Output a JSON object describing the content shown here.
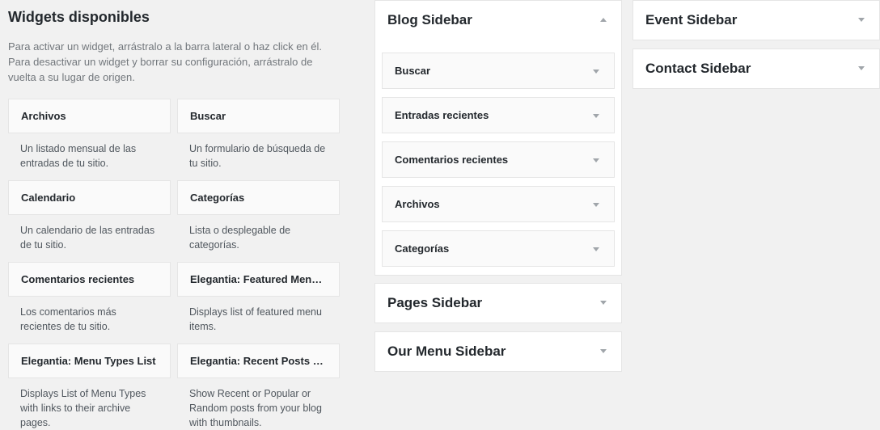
{
  "available": {
    "title": "Widgets disponibles",
    "description_line1": "Para activar un widget, arrástralo a la barra lateral o haz click en él.",
    "description_line2": "Para desactivar un widget y borrar su configuración, arrástralo de",
    "description_line3": "vuelta a su lugar de origen.",
    "widgets": [
      {
        "title": "Archivos",
        "desc_line1": "Un listado mensual de las",
        "desc_line2": "entradas de tu sitio.",
        "desc_line3": ""
      },
      {
        "title": "Buscar",
        "desc_line1": "Un formulario de búsqueda de",
        "desc_line2": "tu sitio.",
        "desc_line3": ""
      },
      {
        "title": "Calendario",
        "desc_line1": "Un calendario de las entradas",
        "desc_line2": "de tu sitio.",
        "desc_line3": ""
      },
      {
        "title": "Categorías",
        "desc_line1": "Lista o desplegable de",
        "desc_line2": "categorías.",
        "desc_line3": ""
      },
      {
        "title": "Comentarios recientes",
        "desc_line1": "Los comentarios más",
        "desc_line2": "recientes de tu sitio.",
        "desc_line3": ""
      },
      {
        "title": "Elegantia: Featured Menu Items",
        "desc_line1": "Displays list of featured menu",
        "desc_line2": "items.",
        "desc_line3": ""
      },
      {
        "title": "Elegantia: Menu Types List",
        "desc_line1": "Displays List of Menu Types",
        "desc_line2": "with links to their archive",
        "desc_line3": "pages."
      },
      {
        "title": "Elegantia: Recent Posts Widget",
        "desc_line1": "Show Recent or Popular or",
        "desc_line2": "Random posts from your blog",
        "desc_line3": "with thumbnails."
      }
    ]
  },
  "sidebars": {
    "blog": {
      "title": "Blog Sidebar",
      "toggle_icon": "arrow-up-icon",
      "widgets": [
        "Buscar",
        "Entradas recientes",
        "Comentarios recientes",
        "Archivos",
        "Categorías"
      ]
    },
    "pages": {
      "title": "Pages Sidebar",
      "toggle_icon": "arrow-down-icon"
    },
    "our_menu": {
      "title": "Our Menu Sidebar",
      "toggle_icon": "arrow-down-icon"
    },
    "event": {
      "title": "Event Sidebar",
      "toggle_icon": "arrow-down-icon"
    },
    "contact": {
      "title": "Contact Sidebar",
      "toggle_icon": "arrow-down-icon"
    }
  },
  "colors": {
    "background": "#f1f1f1",
    "panel": "#ffffff",
    "widget_bg": "#fafafa",
    "border": "#e5e5e5",
    "arrow": "#a0a5aa"
  }
}
